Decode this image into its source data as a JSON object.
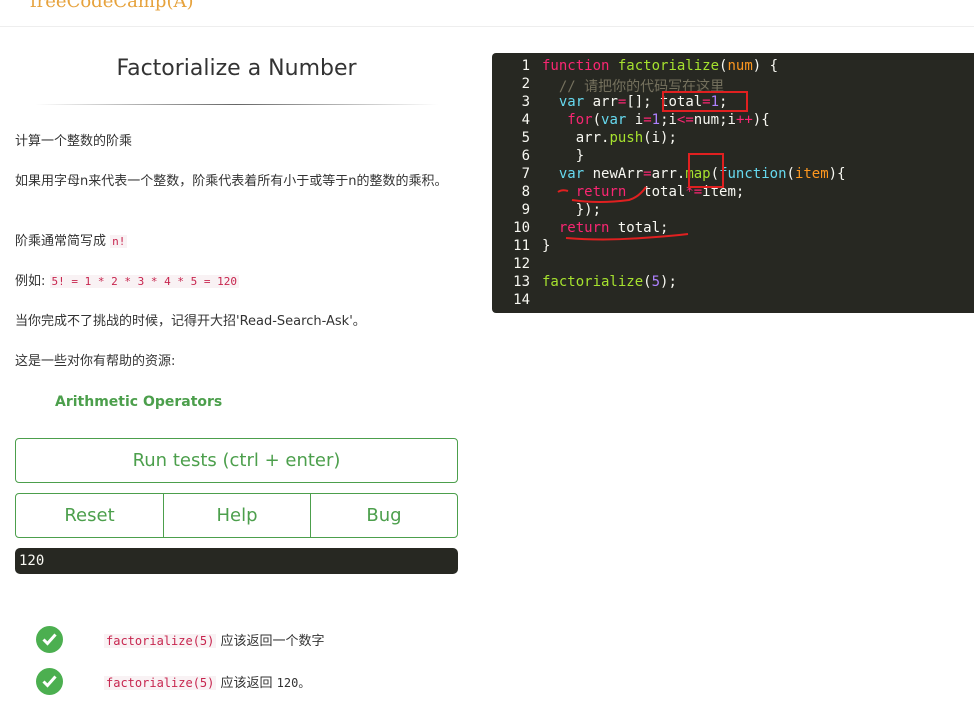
{
  "header": {
    "logo": "freeCodeCamp(A)"
  },
  "challenge": {
    "title": "Factorialize a Number",
    "p1": "计算一个整数的阶乘",
    "p2": "如果用字母n来代表一个整数，阶乘代表着所有小于或等于n的整数的乘积。",
    "p3_text": "阶乘通常简写成 ",
    "p3_code": "n!",
    "p4_text": "例如: ",
    "p4_code": "5! = 1 * 2 * 3 * 4 * 5 = 120",
    "p5": "当你完成不了挑战的时候，记得开大招'Read-Search-Ask'。",
    "p6": "这是一些对你有帮助的资源:",
    "resource_link": "Arithmetic Operators"
  },
  "buttons": {
    "run": "Run tests (ctrl + enter)",
    "reset": "Reset",
    "help": "Help",
    "bug": "Bug"
  },
  "output": "120",
  "tests": [
    {
      "code": "factorialize(5)",
      "text": " 应该返回一个数字",
      "extra": ""
    },
    {
      "code": "factorialize(5)",
      "text": " 应该返回 ",
      "extra": "120。"
    }
  ],
  "editor": {
    "line_numbers": [
      "1",
      "2",
      "3",
      "4",
      "5",
      "6",
      "7",
      "8",
      "9",
      "10",
      "11",
      "12",
      "13",
      "14"
    ],
    "comment": "// 请把你的代码写在这里"
  },
  "colors": {
    "accent": "#4c9f4c",
    "editor_bg": "#272822",
    "annotation": "#e02020"
  }
}
